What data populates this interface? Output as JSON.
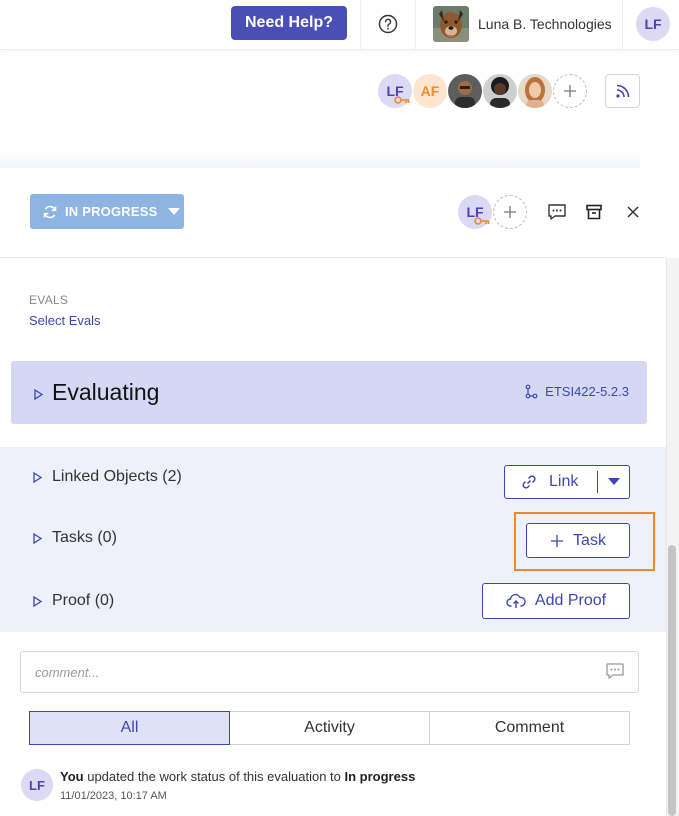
{
  "topbar": {
    "need_help": "Need Help?",
    "org_name": "Luna B. Technologies",
    "user_initials": "LF"
  },
  "participants": [
    {
      "initials": "LF",
      "kind": "initials",
      "color": "#4b44b0"
    },
    {
      "initials": "AF",
      "kind": "initials",
      "color": "#ef8a2c"
    },
    {
      "kind": "photo"
    },
    {
      "kind": "photo"
    },
    {
      "kind": "photo"
    }
  ],
  "status": {
    "label": "IN PROGRESS"
  },
  "header_avatar": "LF",
  "evals": {
    "label": "EVALS",
    "link": "Select Evals"
  },
  "evaluation": {
    "title": "Evaluating",
    "code": "ETSI422-5.2.3"
  },
  "sections": {
    "linked": "Linked Objects (2)",
    "tasks": "Tasks (0)",
    "proof": "Proof (0)"
  },
  "buttons": {
    "link": "Link",
    "task": "Task",
    "add_proof": "Add Proof"
  },
  "comment": {
    "placeholder": "comment..."
  },
  "tabs": [
    {
      "label": "All",
      "active": true
    },
    {
      "label": "Activity",
      "active": false
    },
    {
      "label": "Comment",
      "active": false
    }
  ],
  "activity": {
    "avatar": "LF",
    "actor": "You",
    "text": "updated the work status of this evaluation to",
    "status": "In progress",
    "time": "11/01/2023, 10:17 AM"
  },
  "colors": {
    "brand": "#4a4fb5",
    "accent": "#3d46b3",
    "status_button": "#8eb4e3",
    "highlight": "#f08a24"
  }
}
